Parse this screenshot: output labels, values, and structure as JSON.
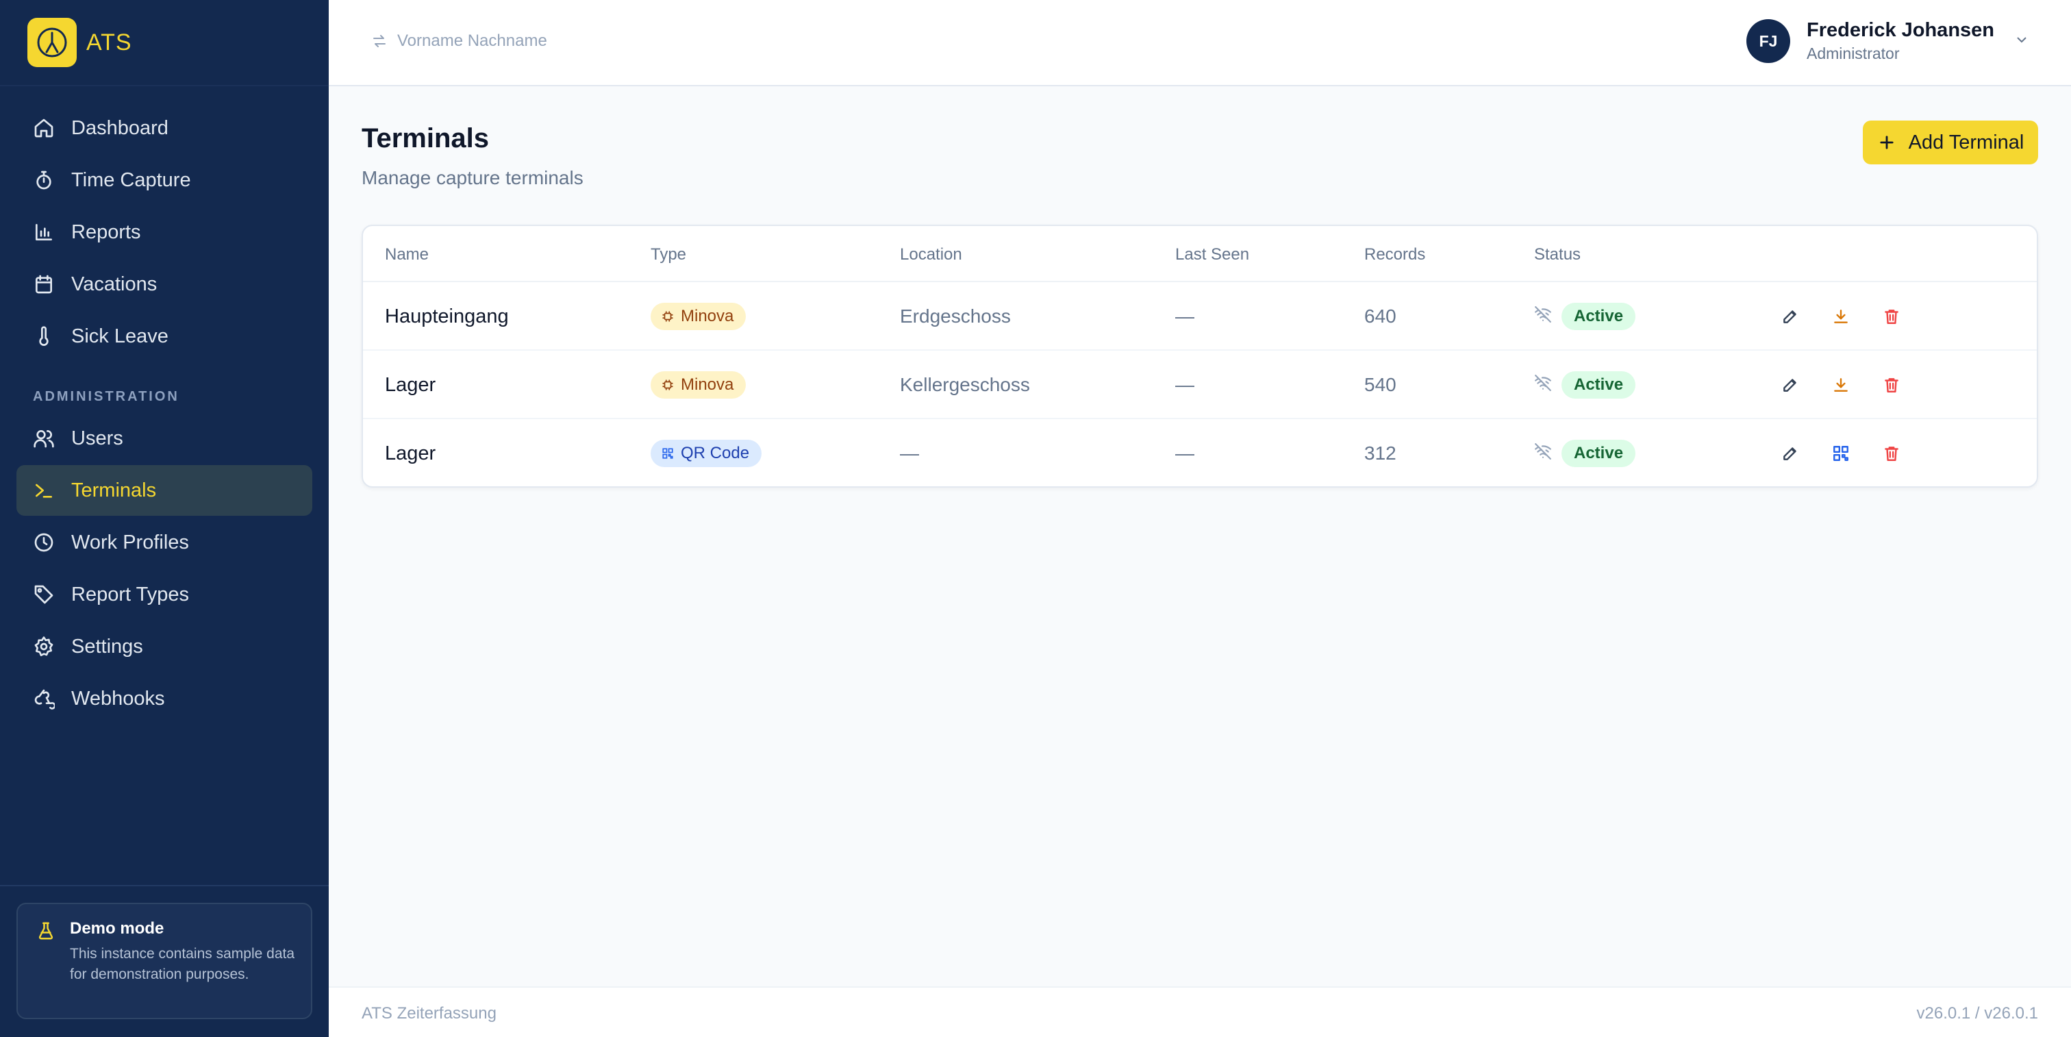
{
  "brand": {
    "name": "ATS"
  },
  "sidebar": {
    "items": [
      {
        "label": "Dashboard",
        "icon": "home-icon"
      },
      {
        "label": "Time Capture",
        "icon": "stopwatch-icon"
      },
      {
        "label": "Reports",
        "icon": "bar-chart-icon"
      },
      {
        "label": "Vacations",
        "icon": "calendar-icon"
      },
      {
        "label": "Sick Leave",
        "icon": "thermometer-icon"
      }
    ],
    "admin_section": "ADMINISTRATION",
    "admin_items": [
      {
        "label": "Users",
        "icon": "users-icon"
      },
      {
        "label": "Terminals",
        "icon": "terminal-icon",
        "active": true
      },
      {
        "label": "Work Profiles",
        "icon": "clock-icon"
      },
      {
        "label": "Report Types",
        "icon": "tag-icon"
      },
      {
        "label": "Settings",
        "icon": "gear-icon"
      },
      {
        "label": "Webhooks",
        "icon": "webhook-icon"
      }
    ],
    "demo": {
      "title": "Demo mode",
      "text": "This instance contains sample data for demonstration purposes."
    }
  },
  "topbar": {
    "switcher_placeholder": "Vorname Nachname",
    "user": {
      "initials": "FJ",
      "name": "Frederick Johansen",
      "role": "Administrator"
    }
  },
  "page": {
    "title": "Terminals",
    "subtitle": "Manage capture terminals",
    "add_button": "Add Terminal"
  },
  "table": {
    "columns": [
      "Name",
      "Type",
      "Location",
      "Last Seen",
      "Records",
      "Status"
    ],
    "rows": [
      {
        "name": "Haupteingang",
        "type": "Minova",
        "location": "Erdgeschoss",
        "last_seen": "—",
        "records": "640",
        "status": "Active"
      },
      {
        "name": "Lager",
        "type": "Minova",
        "location": "Kellergeschoss",
        "last_seen": "—",
        "records": "540",
        "status": "Active"
      },
      {
        "name": "Lager",
        "type": "QR Code",
        "location": "—",
        "last_seen": "—",
        "records": "312",
        "status": "Active"
      }
    ]
  },
  "footer": {
    "left": "ATS Zeiterfassung",
    "right": "v26.0.1 / v26.0.1"
  },
  "colors": {
    "sidebar": "#13294f",
    "accent": "#f5d730",
    "status_active": "#dcfce7"
  }
}
